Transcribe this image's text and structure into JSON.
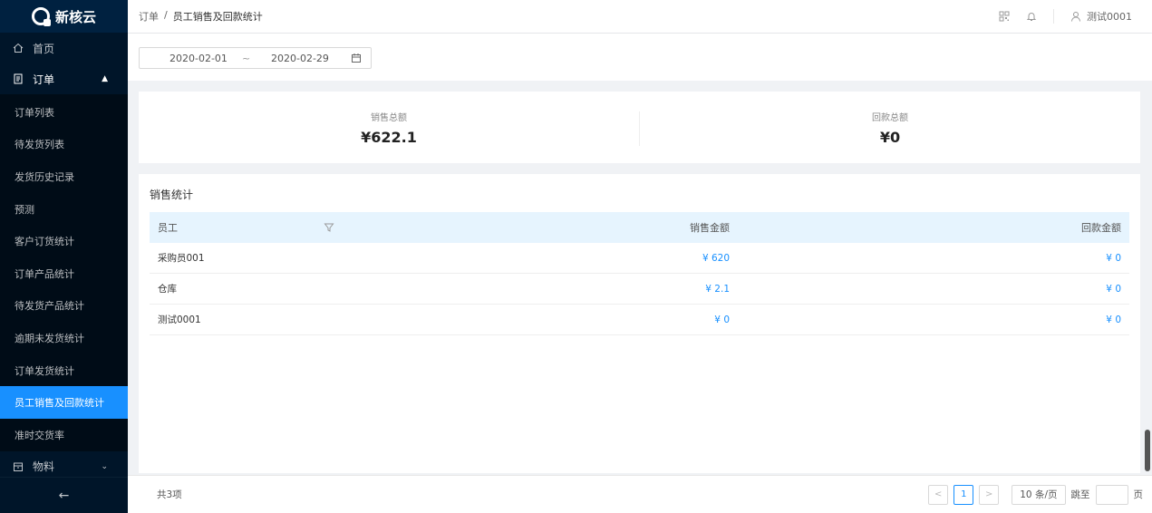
{
  "app": {
    "name": "新核云"
  },
  "sidebar": {
    "home": "首页",
    "orders": "订单",
    "order_items": [
      "订单列表",
      "待发货列表",
      "发货历史记录",
      "预测",
      "客户订货统计",
      "订单产品统计",
      "待发货产品统计",
      "逾期未发货统计",
      "订单发货统计",
      "员工销售及回款统计",
      "准时交货率"
    ],
    "active_index": 9,
    "materials": "物料",
    "collapse": "←"
  },
  "header": {
    "breadcrumb": [
      "订单",
      "员工销售及回款统计"
    ],
    "separator": "/",
    "user": "测试0001"
  },
  "filters": {
    "start_date": "2020-02-01",
    "tilde": "~",
    "end_date": "2020-02-29"
  },
  "summary": {
    "sales_label": "销售总额",
    "sales_value": "¥622.1",
    "refund_label": "回款总额",
    "refund_value": "¥0"
  },
  "table": {
    "title": "销售统计",
    "columns": [
      "员工",
      "销售金额",
      "回款金额"
    ],
    "rows": [
      {
        "employee": "采购员001",
        "sales": "¥ 620",
        "refund": "¥ 0"
      },
      {
        "employee": "仓库",
        "sales": "¥ 2.1",
        "refund": "¥ 0"
      },
      {
        "employee": "测试0001",
        "sales": "¥ 0",
        "refund": "¥ 0"
      }
    ]
  },
  "footer": {
    "total": "共3项",
    "current_page": "1",
    "page_size": "10 条/页",
    "goto_label": "跳至",
    "page_unit": "页"
  },
  "colors": {
    "primary": "#1890ff",
    "sidebar": "#001529",
    "header_row": "#e6f4fe"
  }
}
